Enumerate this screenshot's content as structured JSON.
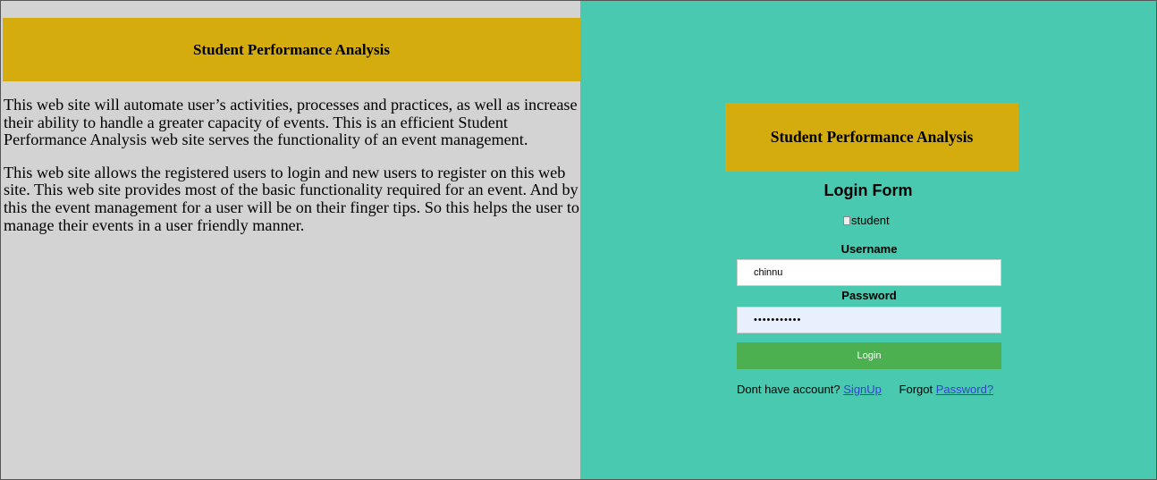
{
  "left_panel": {
    "banner_title": "Student Performance Analysis",
    "paragraph_1": "This web site will automate user’s activities, processes and practices, as well as increase their ability to handle a greater capacity of events. This is an efficient Student Performance Analysis web site serves the functionality of an event management.",
    "paragraph_2": "This web site allows the registered users to login and new users to register on this web site. This web site provides most of the basic functionality required for an event. And by this the event management for a user will be on their finger tips. So this helps the user to manage their events in a user friendly manner."
  },
  "login_panel": {
    "banner_title": "Student Performance Analysis",
    "form_title": "Login Form",
    "image_alt": "student",
    "username_label": "Username",
    "username_value": "chinnu",
    "password_label": "Password",
    "password_value": "chinnu12345",
    "login_button": "Login",
    "signup_prompt": "Dont have account?",
    "signup_link": "SignUp",
    "forgot_prompt": "Forgot",
    "forgot_link": "Password?"
  },
  "colors": {
    "left_background": "#d3d3d3",
    "right_background": "#48c9b0",
    "banner": "#d4ac0d",
    "login_button": "#4caf50",
    "link": "#3a3fd4"
  }
}
